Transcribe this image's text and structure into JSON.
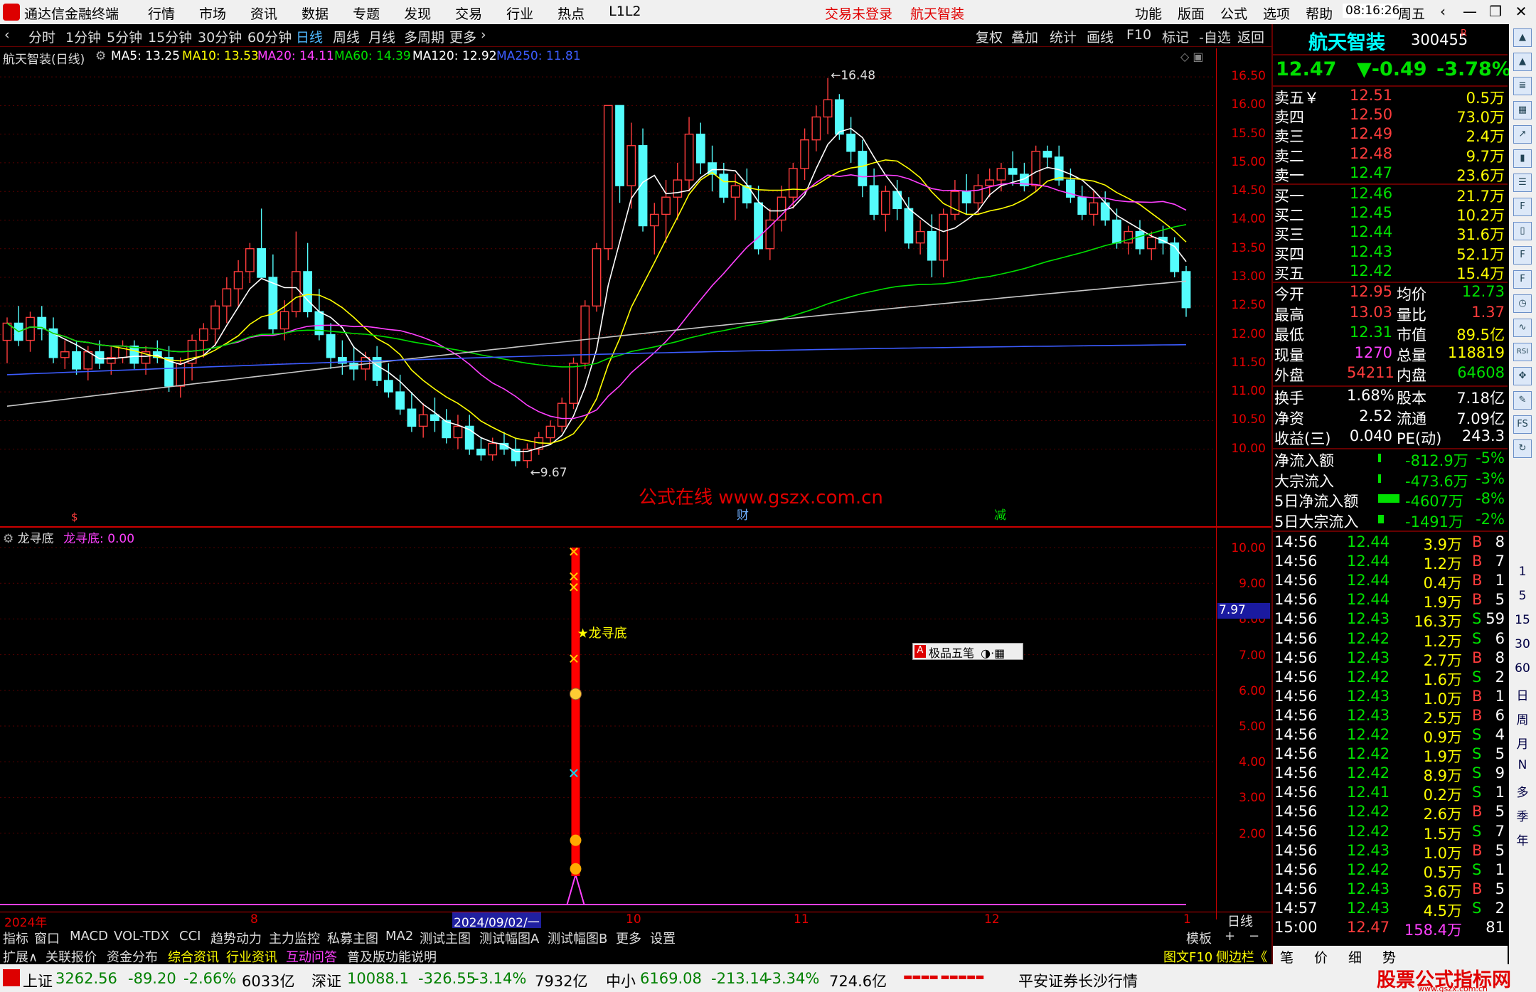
{
  "titlebar": {
    "app_title": "通达信金融终端",
    "menu": [
      "行情",
      "市场",
      "资讯",
      "数据",
      "专题",
      "发现",
      "交易",
      "行业",
      "热点",
      "L1L2"
    ],
    "alerts": [
      "交易未登录",
      "航天智装"
    ],
    "right_menu": [
      "功能",
      "版面",
      "公式",
      "选项",
      "帮助"
    ],
    "time": "08:16:26",
    "weekday": "周五"
  },
  "periodbar": {
    "items": [
      "分时",
      "1分钟",
      "5分钟",
      "15分钟",
      "30分钟",
      "60分钟",
      "日线",
      "周线",
      "月线",
      "多周期",
      "更多"
    ],
    "active": "日线",
    "right_items": [
      "复权",
      "叠加",
      "统计",
      "画线",
      "F10",
      "标记",
      "-自选",
      "返回"
    ]
  },
  "maline": {
    "title": "航天智装(日线)",
    "items": [
      {
        "label": "MA5: 13.25",
        "color": "#ffffff"
      },
      {
        "label": "MA10: 13.53",
        "color": "#ffff00"
      },
      {
        "label": "MA20: 14.11",
        "color": "#ff40ff"
      },
      {
        "label": "MA60: 14.39",
        "color": "#00e000"
      },
      {
        "label": "MA120: 12.92",
        "color": "#ffffff"
      },
      {
        "label": "MA250: 11.81",
        "color": "#3c5cff"
      }
    ]
  },
  "chart_data": {
    "type": "candlestick",
    "ylim": [
      9.3,
      16.7
    ],
    "y_ticks": [
      "16.50",
      "16.00",
      "15.50",
      "15.00",
      "14.50",
      "14.00",
      "13.50",
      "13.00",
      "12.50",
      "12.00",
      "11.50",
      "11.00",
      "10.50",
      "10.00"
    ],
    "x_labels": [
      "2024年",
      "8",
      "2024/09/02/一",
      "10",
      "11",
      "12",
      "1"
    ],
    "annotations": {
      "high": "16.48",
      "low": "9.67",
      "watermark": "公式在线 www.gszx.com.cn",
      "marker_cai": "财",
      "marker_jian": "减",
      "marker_s": "$"
    },
    "candles": [
      [
        11.9,
        12.3,
        11.5,
        12.2
      ],
      [
        12.2,
        12.5,
        11.8,
        11.9
      ],
      [
        11.9,
        12.4,
        11.7,
        12.3
      ],
      [
        12.3,
        12.5,
        11.9,
        12.1
      ],
      [
        12.1,
        12.3,
        11.5,
        11.6
      ],
      [
        11.6,
        11.9,
        11.4,
        11.7
      ],
      [
        11.7,
        11.9,
        11.3,
        11.4
      ],
      [
        11.4,
        11.8,
        11.2,
        11.7
      ],
      [
        11.7,
        11.9,
        11.4,
        11.5
      ],
      [
        11.5,
        11.8,
        11.3,
        11.6
      ],
      [
        11.6,
        11.9,
        11.5,
        11.8
      ],
      [
        11.8,
        11.9,
        11.4,
        11.5
      ],
      [
        11.5,
        11.8,
        11.3,
        11.7
      ],
      [
        11.7,
        11.9,
        11.5,
        11.6
      ],
      [
        11.6,
        11.8,
        11.0,
        11.1
      ],
      [
        11.1,
        11.6,
        10.9,
        11.5
      ],
      [
        11.5,
        12.0,
        11.2,
        11.9
      ],
      [
        11.9,
        12.2,
        11.6,
        12.1
      ],
      [
        12.1,
        12.6,
        11.8,
        12.5
      ],
      [
        12.5,
        13.0,
        12.2,
        12.8
      ],
      [
        12.8,
        13.3,
        12.5,
        13.1
      ],
      [
        13.1,
        13.6,
        12.9,
        13.5
      ],
      [
        13.5,
        14.2,
        13.0,
        13.0
      ],
      [
        13.0,
        13.4,
        12.0,
        12.1
      ],
      [
        12.1,
        12.6,
        11.9,
        12.4
      ],
      [
        12.4,
        13.8,
        12.3,
        13.1
      ],
      [
        13.1,
        13.6,
        12.3,
        12.4
      ],
      [
        12.4,
        12.8,
        11.9,
        12.0
      ],
      [
        12.0,
        12.2,
        11.4,
        11.6
      ],
      [
        11.6,
        11.9,
        11.3,
        11.5
      ],
      [
        11.5,
        11.8,
        11.2,
        11.4
      ],
      [
        11.4,
        11.7,
        11.2,
        11.6
      ],
      [
        11.6,
        11.8,
        11.1,
        11.2
      ],
      [
        11.2,
        11.5,
        10.9,
        11.0
      ],
      [
        11.0,
        11.3,
        10.6,
        10.7
      ],
      [
        10.7,
        11.0,
        10.3,
        10.4
      ],
      [
        10.4,
        10.8,
        10.2,
        10.6
      ],
      [
        10.6,
        10.9,
        10.3,
        10.5
      ],
      [
        10.5,
        10.7,
        10.1,
        10.2
      ],
      [
        10.2,
        10.6,
        10.0,
        10.4
      ],
      [
        10.4,
        10.6,
        9.9,
        10.0
      ],
      [
        10.0,
        10.2,
        9.8,
        9.9
      ],
      [
        9.9,
        10.2,
        9.8,
        10.1
      ],
      [
        10.1,
        10.3,
        9.9,
        10.0
      ],
      [
        10.0,
        10.2,
        9.7,
        9.8
      ],
      [
        9.8,
        10.1,
        9.67,
        10.0
      ],
      [
        10.0,
        10.3,
        9.9,
        10.2
      ],
      [
        10.2,
        10.5,
        10.1,
        10.4
      ],
      [
        10.4,
        10.9,
        10.3,
        10.8
      ],
      [
        10.8,
        11.6,
        10.7,
        11.5
      ],
      [
        11.5,
        12.6,
        11.4,
        12.5
      ],
      [
        12.5,
        13.6,
        12.4,
        13.5
      ],
      [
        13.5,
        16.0,
        13.3,
        16.0
      ],
      [
        16.0,
        16.0,
        14.3,
        14.6
      ],
      [
        14.6,
        15.7,
        14.2,
        15.3
      ],
      [
        15.3,
        15.6,
        13.8,
        13.9
      ],
      [
        13.9,
        14.3,
        13.4,
        14.1
      ],
      [
        14.1,
        14.7,
        13.6,
        14.4
      ],
      [
        14.4,
        15.0,
        14.0,
        14.7
      ],
      [
        14.7,
        15.8,
        14.5,
        15.5
      ],
      [
        15.5,
        15.7,
        14.8,
        15.0
      ],
      [
        15.0,
        15.3,
        14.5,
        14.8
      ],
      [
        14.8,
        15.0,
        14.3,
        14.4
      ],
      [
        14.4,
        14.8,
        14.0,
        14.6
      ],
      [
        14.6,
        14.9,
        14.2,
        14.3
      ],
      [
        14.3,
        14.6,
        13.4,
        13.5
      ],
      [
        13.5,
        14.2,
        13.3,
        14.0
      ],
      [
        14.0,
        14.6,
        13.8,
        14.4
      ],
      [
        14.4,
        15.0,
        14.2,
        14.9
      ],
      [
        14.9,
        15.6,
        14.7,
        15.4
      ],
      [
        15.4,
        16.0,
        15.2,
        15.8
      ],
      [
        15.8,
        16.48,
        15.5,
        16.1
      ],
      [
        16.1,
        16.2,
        15.4,
        15.5
      ],
      [
        15.5,
        15.8,
        15.0,
        15.2
      ],
      [
        15.2,
        15.4,
        14.4,
        14.6
      ],
      [
        14.6,
        14.9,
        14.0,
        14.1
      ],
      [
        14.1,
        14.6,
        13.8,
        14.5
      ],
      [
        14.5,
        14.7,
        14.0,
        14.2
      ],
      [
        14.2,
        14.4,
        13.5,
        13.6
      ],
      [
        13.6,
        14.0,
        13.4,
        13.8
      ],
      [
        13.8,
        14.1,
        13.0,
        13.3
      ],
      [
        13.3,
        14.2,
        13.0,
        14.1
      ],
      [
        14.1,
        14.7,
        14.0,
        14.5
      ],
      [
        14.5,
        14.8,
        14.1,
        14.3
      ],
      [
        14.3,
        14.8,
        14.1,
        14.6
      ],
      [
        14.6,
        14.9,
        14.4,
        14.7
      ],
      [
        14.7,
        15.0,
        14.5,
        14.9
      ],
      [
        14.9,
        15.2,
        14.6,
        14.8
      ],
      [
        14.8,
        15.0,
        14.5,
        14.6
      ],
      [
        14.6,
        15.3,
        14.5,
        15.2
      ],
      [
        15.2,
        15.3,
        14.9,
        15.1
      ],
      [
        15.1,
        15.3,
        14.6,
        14.7
      ],
      [
        14.7,
        14.9,
        14.3,
        14.4
      ],
      [
        14.4,
        14.6,
        14.0,
        14.1
      ],
      [
        14.1,
        14.5,
        13.9,
        14.3
      ],
      [
        14.3,
        14.5,
        13.9,
        14.0
      ],
      [
        14.0,
        14.2,
        13.5,
        13.6
      ],
      [
        13.6,
        13.9,
        13.4,
        13.8
      ],
      [
        13.8,
        14.0,
        13.4,
        13.5
      ],
      [
        13.5,
        13.8,
        13.3,
        13.7
      ],
      [
        13.7,
        13.9,
        13.4,
        13.6
      ],
      [
        13.6,
        13.7,
        13.0,
        13.1
      ],
      [
        13.1,
        13.2,
        12.31,
        12.47
      ]
    ]
  },
  "subchart": {
    "title": "龙寻底",
    "value_label": "龙寻底: 0.00",
    "y_ticks": [
      "10.00",
      "9.00",
      "8.00",
      "7.00",
      "6.00",
      "5.00",
      "4.00",
      "3.00",
      "2.00"
    ],
    "current_value": "7.97",
    "signal_label": "★龙寻底",
    "ime_label": "极品五笔"
  },
  "tabs1": [
    "指标",
    "窗口",
    "MACD",
    "VOL-TDX",
    "CCI",
    "趋势动力",
    "主力监控",
    "私募主图",
    "MA2",
    "测试主图",
    "测试幅图A",
    "测试幅图B",
    "更多",
    "设置"
  ],
  "tabs1_right": [
    "模板",
    "+",
    "−"
  ],
  "tabs2": [
    "扩展∧",
    "关联报价",
    "资金分布",
    "综合资讯",
    "行业资讯",
    "互动问答",
    "普及版功能说明"
  ],
  "tabs2_right": [
    "图文F10",
    "侧边栏《"
  ],
  "rpanel": {
    "name": "航天智装",
    "code": "300455",
    "badge": "R",
    "price": "12.47",
    "change": "▼-0.49",
    "pct": "-3.78%",
    "asks": [
      {
        "label": "卖五￥",
        "price": "12.51",
        "vol": "0.5万"
      },
      {
        "label": "卖四",
        "price": "12.50",
        "vol": "73.0万"
      },
      {
        "label": "卖三",
        "price": "12.49",
        "vol": "2.4万"
      },
      {
        "label": "卖二",
        "price": "12.48",
        "vol": "9.7万"
      },
      {
        "label": "卖一",
        "price": "12.47",
        "vol": "23.6万"
      }
    ],
    "bids": [
      {
        "label": "买一",
        "price": "12.46",
        "vol": "21.7万"
      },
      {
        "label": "买二",
        "price": "12.45",
        "vol": "10.2万"
      },
      {
        "label": "买三",
        "price": "12.44",
        "vol": "31.6万"
      },
      {
        "label": "买四",
        "price": "12.43",
        "vol": "52.1万"
      },
      {
        "label": "买五",
        "price": "12.42",
        "vol": "15.4万"
      }
    ],
    "stats": [
      {
        "l1": "今开",
        "v1": "12.95",
        "l2": "均价",
        "v2": "12.73"
      },
      {
        "l1": "最高",
        "v1": "13.03",
        "l2": "量比",
        "v2": "1.37"
      },
      {
        "l1": "最低",
        "v1": "12.31",
        "l2": "市值",
        "v2": "89.5亿"
      },
      {
        "l1": "现量",
        "v1": "1270",
        "l2": "总量",
        "v2": "118819"
      },
      {
        "l1": "外盘",
        "v1": "54211",
        "l2": "内盘",
        "v2": "64608"
      }
    ],
    "stats2": [
      {
        "l1": "换手",
        "v1": "1.68%",
        "l2": "股本",
        "v2": "7.18亿"
      },
      {
        "l1": "净资",
        "v1": "2.52",
        "l2": "流通",
        "v2": "7.09亿"
      },
      {
        "l1": "收益(三)",
        "v1": "0.040",
        "l2": "PE(动)",
        "v2": "243.3"
      }
    ],
    "flows": [
      {
        "label": "净流入额",
        "value": "-812.9万",
        "pct": "-5%"
      },
      {
        "label": "大宗流入",
        "value": "-473.6万",
        "pct": "-3%"
      },
      {
        "label": "5日净流入额",
        "value": "-4607万",
        "pct": "-8%"
      },
      {
        "label": "5日大宗流入",
        "value": "-1491万",
        "pct": "-2%"
      }
    ],
    "ticks": [
      [
        "14:56",
        "12.44",
        "3.9万",
        "B",
        "8"
      ],
      [
        "14:56",
        "12.44",
        "1.2万",
        "B",
        "7"
      ],
      [
        "14:56",
        "12.44",
        "0.4万",
        "B",
        "1"
      ],
      [
        "14:56",
        "12.44",
        "1.9万",
        "B",
        "5"
      ],
      [
        "14:56",
        "12.43",
        "16.3万",
        "S",
        "59"
      ],
      [
        "14:56",
        "12.42",
        "1.2万",
        "S",
        "6"
      ],
      [
        "14:56",
        "12.43",
        "2.7万",
        "B",
        "8"
      ],
      [
        "14:56",
        "12.42",
        "1.6万",
        "S",
        "2"
      ],
      [
        "14:56",
        "12.43",
        "1.0万",
        "B",
        "1"
      ],
      [
        "14:56",
        "12.43",
        "2.5万",
        "B",
        "6"
      ],
      [
        "14:56",
        "12.42",
        "0.9万",
        "S",
        "4"
      ],
      [
        "14:56",
        "12.42",
        "1.9万",
        "S",
        "5"
      ],
      [
        "14:56",
        "12.42",
        "8.9万",
        "S",
        "9"
      ],
      [
        "14:56",
        "12.41",
        "0.2万",
        "S",
        "1"
      ],
      [
        "14:56",
        "12.42",
        "2.6万",
        "B",
        "5"
      ],
      [
        "14:56",
        "12.42",
        "1.5万",
        "S",
        "7"
      ],
      [
        "14:56",
        "12.43",
        "1.0万",
        "B",
        "5"
      ],
      [
        "14:56",
        "12.42",
        "0.5万",
        "S",
        "1"
      ],
      [
        "14:56",
        "12.43",
        "3.6万",
        "B",
        "5"
      ],
      [
        "14:57",
        "12.43",
        "4.5万",
        "S",
        "2"
      ],
      [
        "15:00",
        "12.47",
        "158.4万",
        "",
        "81"
      ]
    ],
    "bottom_tabs": [
      "笔",
      "价",
      "细",
      "势"
    ]
  },
  "ftool_chars": [
    "1",
    "5",
    "15",
    "30",
    "60",
    "日",
    "周",
    "月",
    "N",
    "多",
    "季",
    "年"
  ],
  "statusbar": {
    "sh_label": "上证",
    "sh_val": "3262.56",
    "sh_chg": "-89.20",
    "sh_pct": "-2.66%",
    "sh_amt": "6033亿",
    "sz_label": "深证",
    "sz_val": "10088.1",
    "sz_chg": "-326.55",
    "sz_pct": "-3.14%",
    "sz_amt": "7932亿",
    "zx_label": "中小",
    "zx_val": "6169.08",
    "zx_chg": "-213.14",
    "zx_pct": "-3.34%",
    "zx_amt": "724.6亿",
    "broker": "平安证券长沙行情",
    "watermark": "股票公式指标网",
    "watermark_url": "www.gszx.com.cn"
  }
}
